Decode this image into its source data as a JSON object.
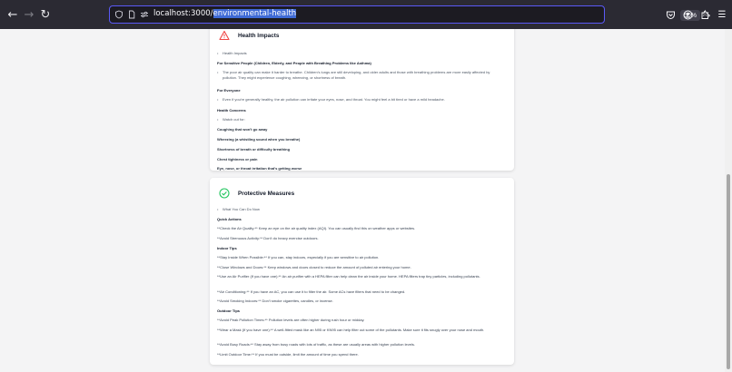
{
  "browser": {
    "url_host": "localhost:3000/",
    "url_path": "environmental-health",
    "zoom": "50%"
  },
  "health": {
    "title": "Health Impacts",
    "intro": "Health Impacts",
    "sensitive_heading": "For Sensitive People (Children, Elderly, and People with Breathing Problems like Asthma)",
    "sensitive_text": "The poor air quality can make it harder to breathe. Children's lungs are still developing, and older adults and those with breathing problems are more easily affected by pollution. They might experience coughing, wheezing, or shortness of breath.",
    "everyone_heading": "For Everyone",
    "everyone_text": "Even if you're generally healthy, the air pollution can irritate your eyes, nose, and throat. You might feel a bit tired or have a mild headache.",
    "concerns_heading": "Health Concerns",
    "watch_out": "Watch out for:",
    "concerns": [
      "Coughing that won't go away",
      "Wheezing (a whistling sound when you breathe)",
      "Shortness of breath or difficulty breathing",
      "Chest tightness or pain",
      "Eye, nose, or throat irritation that's getting worse"
    ]
  },
  "protective": {
    "title": "Protective Measures",
    "intro": "What You Can Do Now",
    "quick_heading": "Quick Actions",
    "quick": [
      "**Check the Air Quality:** Keep an eye on the air quality index (AQI). You can usually find this on weather apps or websites.",
      "**Avoid Strenuous Activity:** Don't do heavy exercise outdoors."
    ],
    "indoor_heading": "Indoor Tips",
    "indoor": [
      "**Stay Inside When Possible:** If you can, stay indoors, especially if you are sensitive to air pollution.",
      "**Close Windows and Doors:** Keep windows and doors closed to reduce the amount of polluted air entering your home.",
      "**Use an Air Purifier (If you have one):** An air purifier with a HEPA filter can help clean the air inside your home. HEPA filters trap tiny particles, including pollutants.",
      "**Air Conditioning:** If you have an AC, you can use it to filter the air. Some ACs have filters that need to be changed.",
      "**Avoid Smoking Indoors:** Don't smoke cigarettes, candles, or incense."
    ],
    "outdoor_heading": "Outdoor Tips",
    "outdoor": [
      "**Avoid Peak Pollution Times:** Pollution levels are often higher during rush hour or midday.",
      "**Wear a Mask (If you have one):** A well-fitted mask like an N95 or KN95 can help filter out some of the pollutants. Make sure it fits snugly over your nose and mouth.",
      "**Avoid Busy Roads:** Stay away from busy roads with lots of traffic, as these are usually areas with higher pollution levels.",
      "**Limit Outdoor Time:** If you must be outside, limit the amount of time you spend there."
    ]
  },
  "icons": {
    "back": "back-arrow-icon",
    "forward": "forward-arrow-icon",
    "reload": "reload-icon",
    "warning": "warning-triangle-icon",
    "check": "check-circle-icon"
  },
  "colors": {
    "warning_red": "#ef4444",
    "check_green": "#22c55e",
    "url_selection": "#3f6bd6"
  }
}
